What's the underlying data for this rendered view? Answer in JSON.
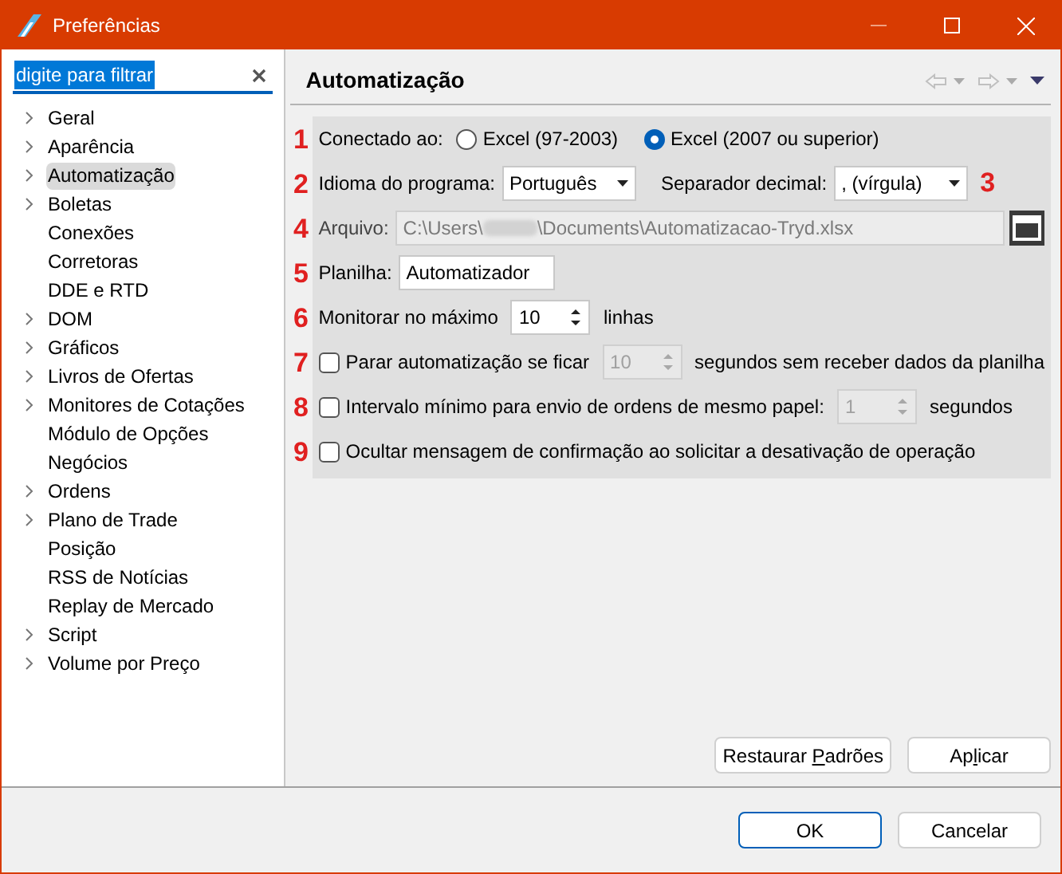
{
  "window": {
    "title": "Preferências"
  },
  "filter": {
    "value": "digite para filtrar",
    "text_selected": true
  },
  "tree": [
    {
      "label": "Geral",
      "expandable": true,
      "selected": false
    },
    {
      "label": "Aparência",
      "expandable": true,
      "selected": false
    },
    {
      "label": "Automatização",
      "expandable": true,
      "selected": true
    },
    {
      "label": "Boletas",
      "expandable": true,
      "selected": false
    },
    {
      "label": "Conexões",
      "expandable": false,
      "selected": false
    },
    {
      "label": "Corretoras",
      "expandable": false,
      "selected": false
    },
    {
      "label": "DDE e RTD",
      "expandable": false,
      "selected": false
    },
    {
      "label": "DOM",
      "expandable": true,
      "selected": false
    },
    {
      "label": "Gráficos",
      "expandable": true,
      "selected": false
    },
    {
      "label": "Livros de Ofertas",
      "expandable": true,
      "selected": false
    },
    {
      "label": "Monitores de Cotações",
      "expandable": true,
      "selected": false
    },
    {
      "label": "Módulo de Opções",
      "expandable": false,
      "selected": false
    },
    {
      "label": "Negócios",
      "expandable": false,
      "selected": false
    },
    {
      "label": "Ordens",
      "expandable": true,
      "selected": false
    },
    {
      "label": "Plano de Trade",
      "expandable": true,
      "selected": false
    },
    {
      "label": "Posição",
      "expandable": false,
      "selected": false
    },
    {
      "label": "RSS de Notícias",
      "expandable": false,
      "selected": false
    },
    {
      "label": "Replay de Mercado",
      "expandable": false,
      "selected": false
    },
    {
      "label": "Script",
      "expandable": true,
      "selected": false
    },
    {
      "label": "Volume por Preço",
      "expandable": true,
      "selected": false
    }
  ],
  "page": {
    "title": "Automatização"
  },
  "rows": [
    {
      "kind": "radio",
      "marker": "1",
      "label": "Conectado ao:",
      "options": [
        {
          "label": "Excel (97-2003)",
          "selected": false
        },
        {
          "label": "Excel (2007 ou superior)",
          "selected": true
        }
      ]
    },
    {
      "kind": "selects",
      "marker": "2",
      "fields": [
        {
          "label": "Idioma do programa:",
          "value": "Português"
        },
        {
          "label": "Separador decimal:",
          "value": ", (vírgula)"
        }
      ],
      "marker_after": "3"
    },
    {
      "kind": "file",
      "marker": "4",
      "label": "Arquivo:",
      "path_start": "C:\\Users\\",
      "path_end": "\\Documents\\Automatizacao-Tryd.xlsx",
      "disabled": true
    },
    {
      "kind": "text",
      "marker": "5",
      "label": "Planilha:",
      "value": "Automatizador"
    },
    {
      "kind": "spinner",
      "marker": "6",
      "label": "Monitorar no máximo",
      "value": "10",
      "suffix": "linhas",
      "disabled": false
    },
    {
      "kind": "check",
      "marker": "7",
      "checked": false,
      "label": "Parar automatização se ficar",
      "spinner": {
        "value": "10",
        "disabled": true
      },
      "suffix": "segundos sem receber dados da planilha"
    },
    {
      "kind": "check",
      "marker": "8",
      "checked": false,
      "label": "Intervalo mínimo para envio de ordens de mesmo papel:",
      "spinner": {
        "value": "1",
        "disabled": true
      },
      "suffix": "segundos"
    },
    {
      "kind": "check",
      "marker": "9",
      "checked": false,
      "label": "Ocultar mensagem de confirmação ao solicitar a desativação de operação"
    }
  ],
  "page_buttons": [
    {
      "before": "Restaurar ",
      "mnemonic": "P",
      "after": "adrões"
    },
    {
      "before": "Ap",
      "mnemonic": "l",
      "after": "icar"
    }
  ],
  "dialog_buttons": [
    {
      "label": "OK",
      "default": true
    },
    {
      "label": "Cancelar",
      "default": false
    }
  ]
}
